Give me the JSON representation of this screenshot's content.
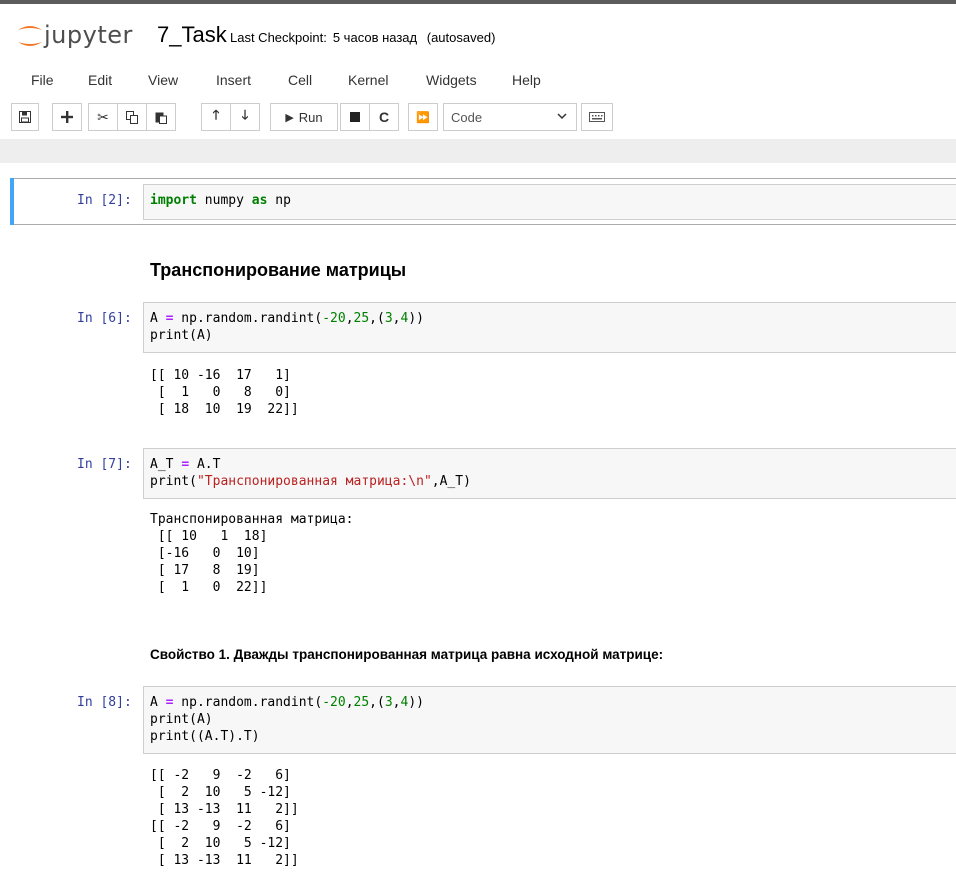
{
  "header": {
    "logo_text": "jupyter",
    "notebook_name": "7_Task",
    "checkpoint_label": "Last Checkpoint:",
    "checkpoint_time": "5 часов назад",
    "autosave_status": "(autosaved)"
  },
  "menu": [
    "File",
    "Edit",
    "View",
    "Insert",
    "Cell",
    "Kernel",
    "Widgets",
    "Help"
  ],
  "toolbar": {
    "run_label": "Run",
    "cell_type": "Code"
  },
  "cells": {
    "c1": {
      "prompt": "In [2]:",
      "line1": {
        "kw1": "import",
        "t1": " numpy ",
        "kw2": "as",
        "t2": " np"
      }
    },
    "md1": "Транспонирование матрицы",
    "c2": {
      "prompt": "In [6]:",
      "line1": {
        "a": "A ",
        "eq": "=",
        "b": " np.random.randint(",
        "n1": "-20",
        "c1": ",",
        "n2": "25",
        "c2": ",(",
        "n3": "3",
        "c3": ",",
        "n4": "4",
        "e": "))"
      },
      "line2": "print(A)",
      "output": [
        "[[ 10 -16  17   1]",
        " [  1   0   8   0]",
        " [ 18  10  19  22]]"
      ]
    },
    "c3": {
      "prompt": "In [7]:",
      "line1": {
        "a": "A_T ",
        "eq": "=",
        "b": " A.T"
      },
      "line2": {
        "a": "print(",
        "s": "\"Транспонированная матрица:\\n\"",
        "b": ",A_T)"
      },
      "output": [
        "Транспонированная матрица:",
        " [[ 10   1  18]",
        " [-16   0  10]",
        " [ 17   8  19]",
        " [  1   0  22]]"
      ]
    },
    "md2": "Свойство 1. Дважды транспонированная матрица равна исходной матрице:",
    "c4": {
      "prompt": "In [8]:",
      "line1": {
        "a": "A ",
        "eq": "=",
        "b": " np.random.randint(",
        "n1": "-20",
        "c1": ",",
        "n2": "25",
        "c2": ",(",
        "n3": "3",
        "c3": ",",
        "n4": "4",
        "e": "))"
      },
      "line2": "print(A)",
      "line3": "print((A.T).T)",
      "output": [
        "[[ -2   9  -2   6]",
        " [  2  10   5 -12]",
        " [ 13 -13  11   2]]",
        "[[ -2   9  -2   6]",
        " [  2  10   5 -12]",
        " [ 13 -13  11   2]]"
      ]
    }
  }
}
